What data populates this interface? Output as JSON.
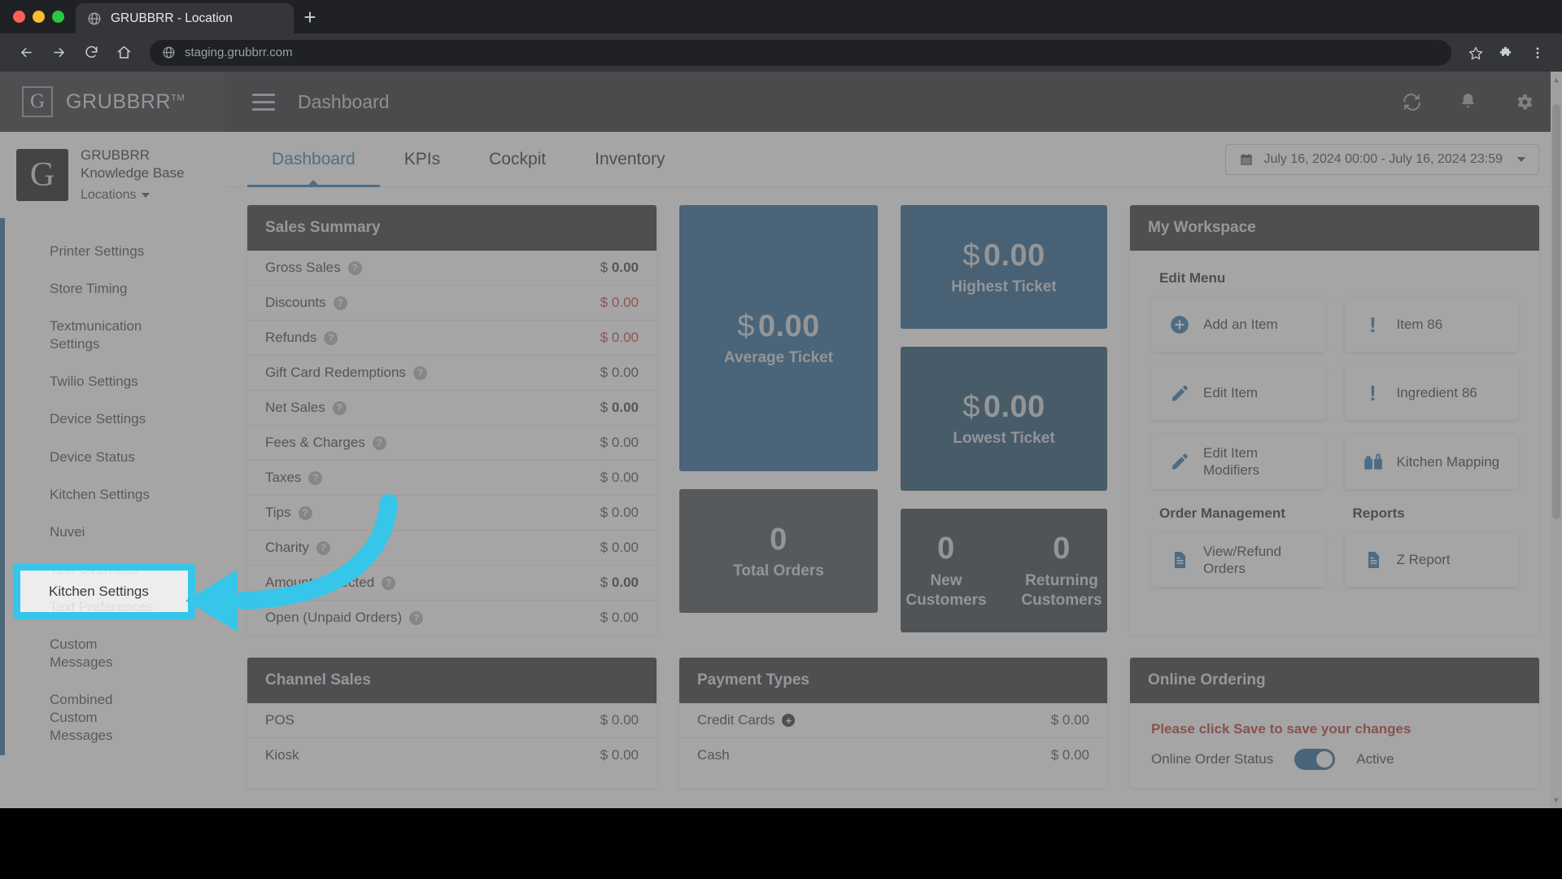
{
  "browser": {
    "tab_title": "GRUBBRR - Location",
    "tab_favicon": "globe-icon",
    "new_tab_label": "+",
    "url": "staging.grubbrr.com",
    "back_icon": "back-arrow-icon",
    "forward_icon": "forward-arrow-icon",
    "reload_icon": "reload-icon",
    "home_icon": "home-icon",
    "bookmark_icon": "star-icon",
    "extensions_icon": "puzzle-icon",
    "menu_icon": "three-dot-menu-icon"
  },
  "sidebar": {
    "brand": "GRUBBRR",
    "brand_tm": "TM",
    "brand_logo_letter": "G",
    "location_avatar_letter": "G",
    "location_name": "GRUBBRR\nKnowledge Base",
    "location_selector": "Locations",
    "items": [
      {
        "label": "Printer Settings"
      },
      {
        "label": "Store Timing"
      },
      {
        "label": "Textmunication Settings"
      },
      {
        "label": "Twilio Settings"
      },
      {
        "label": "Device Settings"
      },
      {
        "label": "Device Status"
      },
      {
        "label": "Kitchen Settings"
      },
      {
        "label": "Nuvei"
      },
      {
        "label": "Text Overrides"
      },
      {
        "label": "Text Preferences"
      },
      {
        "label": "Custom Messages"
      },
      {
        "label": "Combined Custom Messages"
      }
    ]
  },
  "annotation": {
    "highlighted_item": "Kitchen Settings",
    "highlight_color": "#35c6ea",
    "arrow_color": "#35c6ea"
  },
  "topbar": {
    "menu_icon": "hamburger-menu-icon",
    "title": "Dashboard",
    "refresh_icon": "refresh-icon",
    "notifications_icon": "bell-icon",
    "settings_icon": "gear-icon"
  },
  "tabs": [
    {
      "label": "Dashboard",
      "active": true
    },
    {
      "label": "KPIs",
      "active": false
    },
    {
      "label": "Cockpit",
      "active": false
    },
    {
      "label": "Inventory",
      "active": false
    }
  ],
  "date_range": {
    "icon": "calendar-icon",
    "value": "July 16, 2024 00:00 - July 16, 2024 23:59",
    "caret": "chevron-down-icon"
  },
  "sales_summary": {
    "title": "Sales Summary",
    "rows": [
      {
        "label": "Gross Sales",
        "currency": "$",
        "amount": "0.00",
        "style": "bold"
      },
      {
        "label": "Discounts",
        "currency": "$",
        "amount": "0.00",
        "style": "red"
      },
      {
        "label": "Refunds",
        "currency": "$",
        "amount": "0.00",
        "style": "red"
      },
      {
        "label": "Gift Card Redemptions",
        "currency": "$",
        "amount": "0.00",
        "style": "mut"
      },
      {
        "label": "Net Sales",
        "currency": "$",
        "amount": "0.00",
        "style": "bold"
      },
      {
        "label": "Fees & Charges",
        "currency": "$",
        "amount": "0.00",
        "style": "mut"
      },
      {
        "label": "Taxes",
        "currency": "$",
        "amount": "0.00",
        "style": "mut"
      },
      {
        "label": "Tips",
        "currency": "$",
        "amount": "0.00",
        "style": "mut"
      },
      {
        "label": "Charity",
        "currency": "$",
        "amount": "0.00",
        "style": "mut"
      },
      {
        "label": "Amount Collected",
        "currency": "$",
        "amount": "0.00",
        "style": "bold"
      },
      {
        "label": "Open (Unpaid Orders)",
        "currency": "$",
        "amount": "0.00",
        "style": "mut"
      }
    ]
  },
  "kpis": {
    "average_ticket": {
      "currency": "$",
      "value": "0.00",
      "label": "Average Ticket"
    },
    "highest_ticket": {
      "currency": "$",
      "value": "0.00",
      "label": "Highest Ticket"
    },
    "lowest_ticket": {
      "currency": "$",
      "value": "0.00",
      "label": "Lowest Ticket"
    },
    "total_orders": {
      "value": "0",
      "label": "Total Orders"
    },
    "new_customers": {
      "value": "0",
      "label": "New Customers"
    },
    "returning_customers": {
      "value": "0",
      "label": "Returning Customers"
    }
  },
  "workspace": {
    "title": "My Workspace",
    "sections": [
      {
        "heading": "Edit Menu",
        "buttons": [
          {
            "label": "Add an Item",
            "icon": "plus-circle-icon"
          },
          {
            "label": "Item 86",
            "icon": "exclamation-icon"
          },
          {
            "label": "Edit Item",
            "icon": "pencil-icon"
          },
          {
            "label": "Ingredient 86",
            "icon": "exclamation-icon"
          },
          {
            "label": "Edit Item Modifiers",
            "icon": "pencil-icon"
          },
          {
            "label": "Kitchen Mapping",
            "icon": "kitchen-mapping-icon"
          }
        ]
      }
    ],
    "order_management": {
      "heading": "Order Management",
      "buttons": [
        {
          "label": "View/Refund Orders",
          "icon": "document-icon"
        }
      ]
    },
    "reports": {
      "heading": "Reports",
      "buttons": [
        {
          "label": "Z Report",
          "icon": "document-icon"
        }
      ]
    }
  },
  "channel_sales": {
    "title": "Channel Sales",
    "rows": [
      {
        "label": "POS",
        "currency": "$",
        "amount": "0.00"
      },
      {
        "label": "Kiosk",
        "currency": "$",
        "amount": "0.00"
      }
    ]
  },
  "payment_types": {
    "title": "Payment Types",
    "rows": [
      {
        "label": "Credit Cards",
        "currency": "$",
        "amount": "0.00",
        "expand_icon": "plus-circle-icon"
      },
      {
        "label": "Cash",
        "currency": "$",
        "amount": "0.00"
      }
    ]
  },
  "online_ordering": {
    "title": "Online Ordering",
    "warning": "Please click Save to save your changes",
    "status_label": "Online Order Status",
    "status_value": "Active",
    "toggle_on": true
  }
}
